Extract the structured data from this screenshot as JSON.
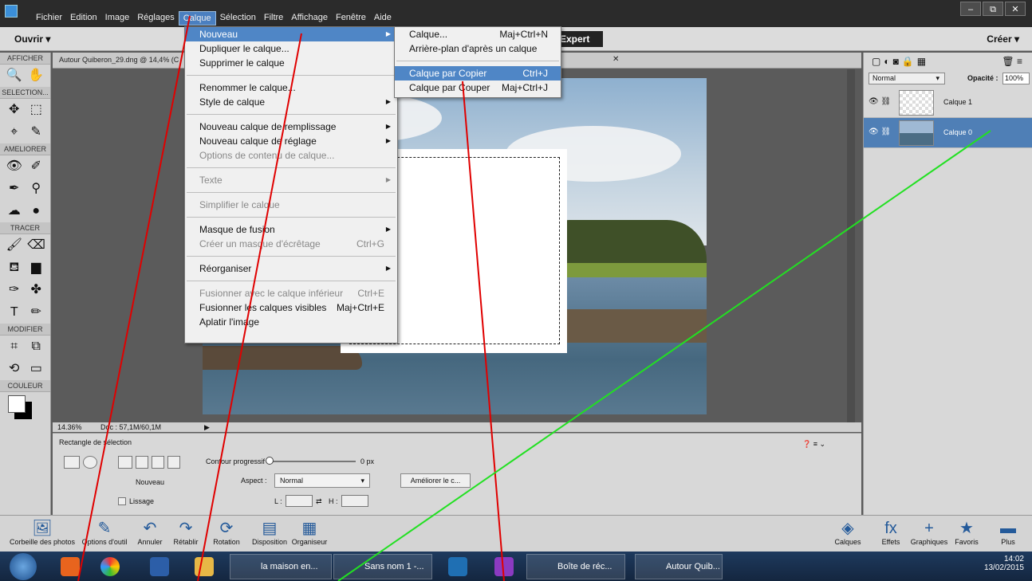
{
  "menubar": {
    "items": [
      "Fichier",
      "Edition",
      "Image",
      "Réglages",
      "Calque",
      "Sélection",
      "Filtre",
      "Affichage",
      "Fenêtre",
      "Aide"
    ],
    "active": "Calque",
    "window_controls": [
      "–",
      "⧉",
      "✕"
    ]
  },
  "toprow": {
    "open_label": "Ouvrir ▾",
    "create_label": "Créer ▾",
    "expert_label": "Expert"
  },
  "toolbar": {
    "sections": [
      "AFFICHER",
      "SELECTION...",
      "AMELIORER",
      "TRACER",
      "MODIFIER",
      "COULEUR"
    ]
  },
  "document": {
    "tab_title": "Autour Quiberon_29.dng @ 14,4% (C",
    "tab_close": "✕",
    "zoom": "14.36%",
    "doc_size": "Doc : 57,1M/60,1M"
  },
  "options": {
    "title": "Rectangle de sélection",
    "new_label": "Nouveau",
    "smooth_label": "Lissage",
    "feather_label": "Contour progressif :",
    "feather_value": "0 px",
    "aspect_label": "Aspect :",
    "aspect_value": "Normal",
    "width_label": "L :",
    "height_label": "H :",
    "refine_button": "Améliorer le c..."
  },
  "layers_panel": {
    "blend_mode": "Normal",
    "opacity_label": "Opacité :",
    "opacity_value": "100%",
    "layers": [
      {
        "name": "Calque 1",
        "selected": false
      },
      {
        "name": "Calque 0",
        "selected": true
      }
    ]
  },
  "calque_menu": [
    {
      "label": "Nouveau",
      "highlight": true,
      "submenu": true
    },
    {
      "label": "Dupliquer le calque..."
    },
    {
      "label": "Supprimer le calque"
    },
    {
      "sep": true
    },
    {
      "label": "Renommer le calque..."
    },
    {
      "label": "Style de calque",
      "submenu": true
    },
    {
      "sep": true
    },
    {
      "label": "Nouveau calque de remplissage",
      "submenu": true
    },
    {
      "label": "Nouveau calque de réglage",
      "submenu": true
    },
    {
      "label": "Options de contenu de calque...",
      "disabled": true
    },
    {
      "sep": true
    },
    {
      "label": "Texte",
      "disabled": true,
      "submenu": true
    },
    {
      "sep": true
    },
    {
      "label": "Simplifier le calque",
      "disabled": true
    },
    {
      "sep": true
    },
    {
      "label": "Masque de fusion",
      "submenu": true
    },
    {
      "label": "Créer un masque d'écrêtage",
      "disabled": true,
      "shortcut": "Ctrl+G"
    },
    {
      "sep": true
    },
    {
      "label": "Réorganiser",
      "submenu": true
    },
    {
      "sep": true
    },
    {
      "label": "Fusionner avec le calque inférieur",
      "disabled": true,
      "shortcut": "Ctrl+E"
    },
    {
      "label": "Fusionner les calques visibles",
      "shortcut": "Maj+Ctrl+E"
    },
    {
      "label": "Aplatir l'image"
    }
  ],
  "nouveau_submenu": [
    {
      "label": "Calque...",
      "shortcut": "Maj+Ctrl+N"
    },
    {
      "label": "Arrière-plan d'après un calque"
    },
    {
      "sep": true
    },
    {
      "label": "Calque par Copier",
      "shortcut": "Ctrl+J",
      "highlight": true
    },
    {
      "label": "Calque par Couper",
      "shortcut": "Maj+Ctrl+J"
    }
  ],
  "bottombar": {
    "left": [
      "Corbeille des photos",
      "Options d'outil",
      "Annuler",
      "Rétablir",
      "Rotation",
      "Disposition",
      "Organiseur"
    ],
    "right": [
      "Calques",
      "Effets",
      "Graphiques",
      "Favoris",
      "Plus"
    ]
  },
  "taskbar": {
    "buttons": [
      "la maison en...",
      "Sans nom 1 -...",
      "Boîte de réc...",
      "Autour Quib..."
    ],
    "time": "14:02",
    "date": "13/02/2015"
  }
}
